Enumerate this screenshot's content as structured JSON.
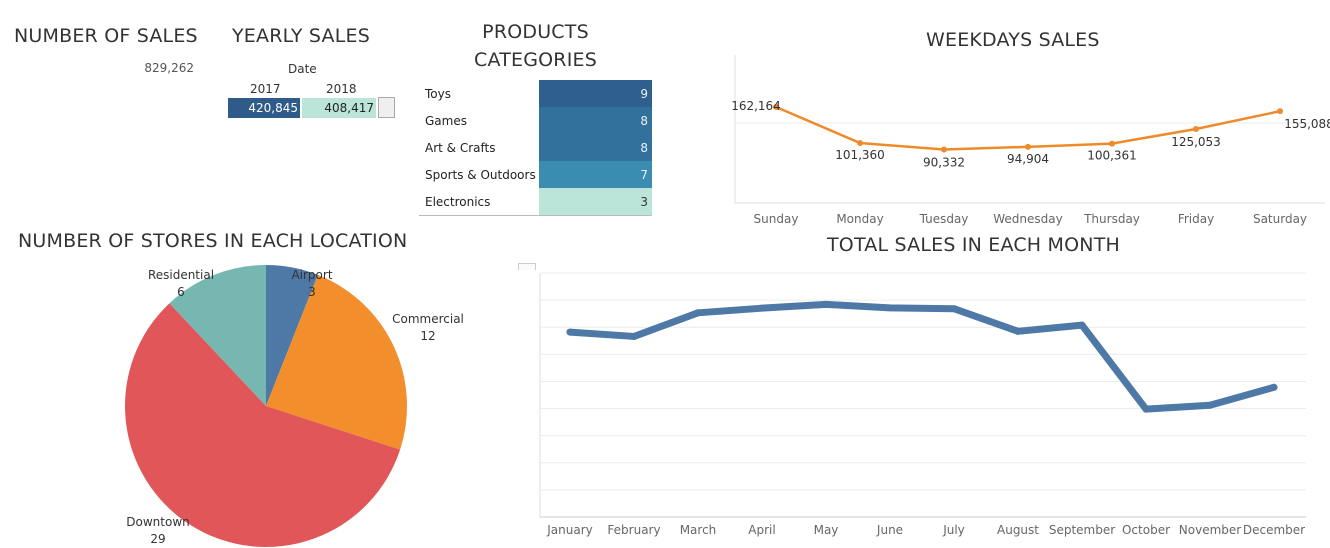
{
  "colors": {
    "dark_blue": "#2e5b8a",
    "teal_light": "#bce5d9",
    "orange": "#ef8a2b",
    "line_blue": "#4e79a7"
  },
  "number_of_sales": {
    "title": "NUMBER OF SALES",
    "value": "829,262"
  },
  "yearly_sales": {
    "title": "YEARLY SALES",
    "header": "Date",
    "years": [
      "2017",
      "2018"
    ],
    "values": [
      "420,845",
      "408,417"
    ]
  },
  "product_categories": {
    "title_line1": "PRODUCTS",
    "title_line2": "CATEGORIES",
    "rows": [
      {
        "name": "Toys",
        "value": "9",
        "color": "#2f5f8c"
      },
      {
        "name": "Games",
        "value": "8",
        "color": "#32719b"
      },
      {
        "name": "Art & Crafts",
        "value": "8",
        "color": "#32719b"
      },
      {
        "name": "Sports & Outdoors",
        "value": "7",
        "color": "#3a8db1"
      },
      {
        "name": "Electronics",
        "value": "3",
        "color": "#bce5d9"
      }
    ]
  },
  "weekdays_sales": {
    "title": "WEEKDAYS SALES"
  },
  "stores_location": {
    "title": "NUMBER OF STORES IN EACH LOCATION"
  },
  "monthly_sales": {
    "title": "TOTAL SALES IN EACH MONTH"
  },
  "chart_data": [
    {
      "type": "line",
      "title": "WEEKDAYS SALES",
      "categories": [
        "Sunday",
        "Monday",
        "Tuesday",
        "Wednesday",
        "Thursday",
        "Friday",
        "Saturday"
      ],
      "values": [
        162164,
        101360,
        90332,
        94904,
        100361,
        125053,
        155088
      ],
      "labels": [
        "162,164",
        "101,360",
        "90,332",
        "94,904",
        "100,361",
        "125,053",
        "155,088"
      ],
      "ylim": [
        0,
        250000
      ],
      "color": "#ef8a2b"
    },
    {
      "type": "pie",
      "title": "NUMBER OF STORES IN EACH LOCATION",
      "slices": [
        {
          "label": "Airport",
          "value": 3,
          "color": "#4e79a7"
        },
        {
          "label": "Commercial",
          "value": 12,
          "color": "#f28e2b"
        },
        {
          "label": "Downtown",
          "value": 29,
          "color": "#e15759"
        },
        {
          "label": "Residential",
          "value": 6,
          "color": "#76b7b2"
        }
      ]
    },
    {
      "type": "line",
      "title": "TOTAL SALES IN EACH MONTH",
      "categories": [
        "January",
        "February",
        "March",
        "April",
        "May",
        "June",
        "July",
        "August",
        "September",
        "October",
        "November",
        "December"
      ],
      "values": [
        72000,
        70300,
        79500,
        81300,
        82800,
        81400,
        81100,
        72300,
        74700,
        42000,
        43500,
        50500
      ],
      "ylim": [
        0,
        95000
      ],
      "color": "#4e79a7"
    }
  ]
}
